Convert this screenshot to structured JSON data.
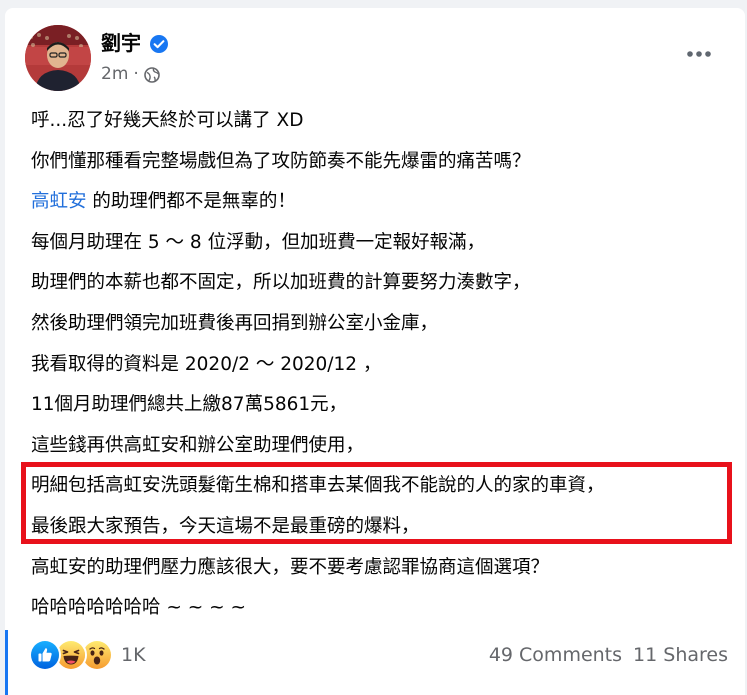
{
  "post": {
    "author": "劉宇",
    "time": "2m",
    "dot": "·",
    "lines": [
      "呼...忍了好幾天終於可以講了 XD",
      "你們懂那種看完整場戲但為了攻防節奏不能先爆雷的痛苦嗎？",
      "",
      "每個月助理在 5 ～ 8 位浮動，但加班費一定報好報滿，",
      "助理們的本薪也都不固定，所以加班費的計算要努力湊數字，",
      "然後助理們領完加班費後再回捐到辦公室小金庫，",
      "我看取得的資料是 2020/2 ～ 2020/12 ，",
      "11個月助理們總共上繳87萬5861元，",
      "這些錢再供高虹安和辦公室助理們使用，",
      "明細包括高虹安洗頭髮衛生棉和搭車去某個我不能說的人的家的車資，",
      "最後跟大家預告，今天這場不是最重磅的爆料，",
      "高虹安的助理們壓力應該很大，要不要考慮認罪協商這個選項？",
      "哈哈哈哈哈哈哈 ~ ~ ~ ~"
    ],
    "mention": "高虹安",
    "mention_suffix": " 的助理們都不是無辜的！"
  },
  "reactions": {
    "icons": [
      "like-icon",
      "haha-icon",
      "wow-icon"
    ],
    "count": "1K"
  },
  "engagement": {
    "comments": "49 Comments",
    "shares": "11 Shares"
  },
  "colors": {
    "mention": "#216fdb",
    "highlight_border": "#e8111b",
    "verified": "#1877f2",
    "secondary_text": "#65676b"
  }
}
